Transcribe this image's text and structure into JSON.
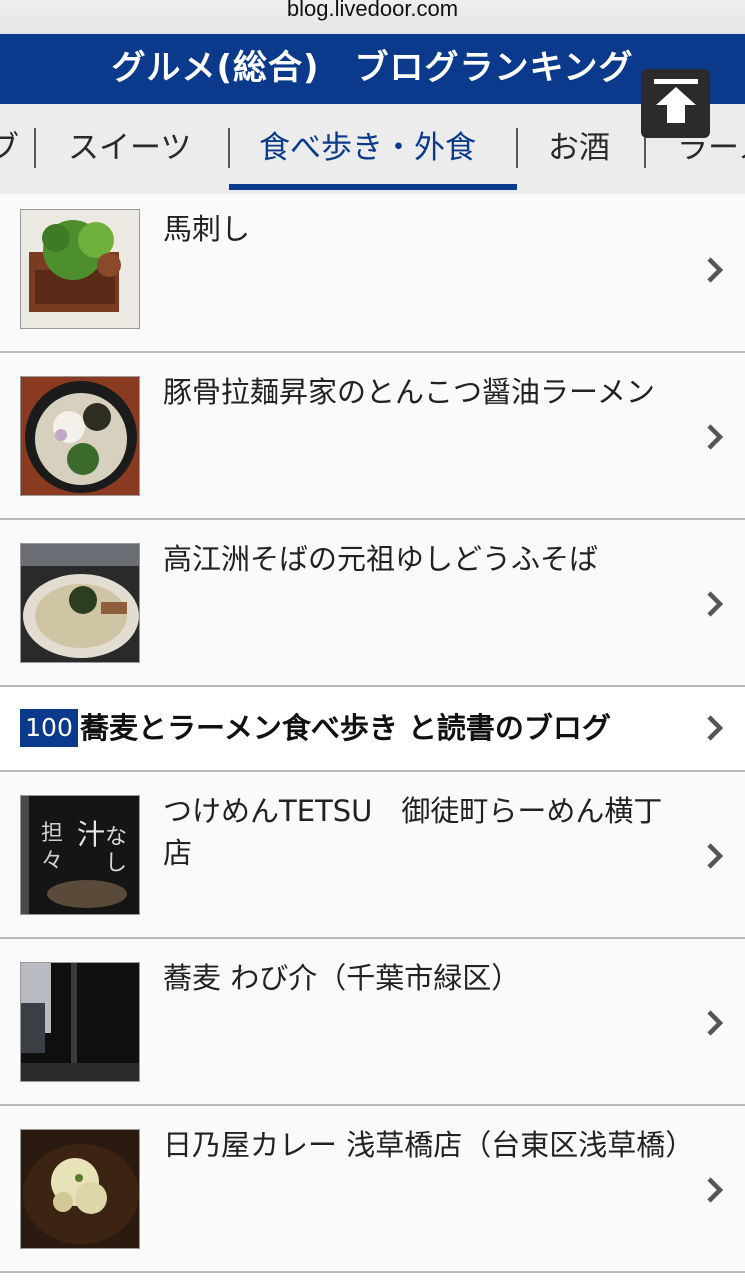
{
  "browser": {
    "url": "blog.livedoor.com"
  },
  "header": {
    "title": "グルメ(総合)　ブログランキング"
  },
  "tabs": [
    {
      "label": "ブ",
      "active": false
    },
    {
      "label": "スイーツ",
      "active": false
    },
    {
      "label": "食べ歩き・外食",
      "active": true
    },
    {
      "label": "お酒",
      "active": false
    },
    {
      "label": "ラーメ",
      "active": false
    }
  ],
  "entries": [
    {
      "title": "馬刺し"
    },
    {
      "title": "豚骨拉麺昇家のとんこつ醤油ラーメン"
    },
    {
      "title": "高江洲そばの元祖ゆしどうふそば"
    }
  ],
  "blog": {
    "rank": "100",
    "name": "蕎麦とラーメン食べ歩き と読書のブログ"
  },
  "entries2": [
    {
      "title": "つけめんTETSU　御徒町らーめん横丁店"
    },
    {
      "title": "蕎麦 わび介（千葉市緑区）"
    },
    {
      "title": "日乃屋カレー 浅草橋店（台東区浅草橋）"
    }
  ],
  "colors": {
    "brand": "#0b3a8c",
    "tab_bg": "#ececec"
  },
  "icons": {
    "scroll_top": "arrow-up-icon",
    "row_chevron": "chevron-right-icon"
  }
}
